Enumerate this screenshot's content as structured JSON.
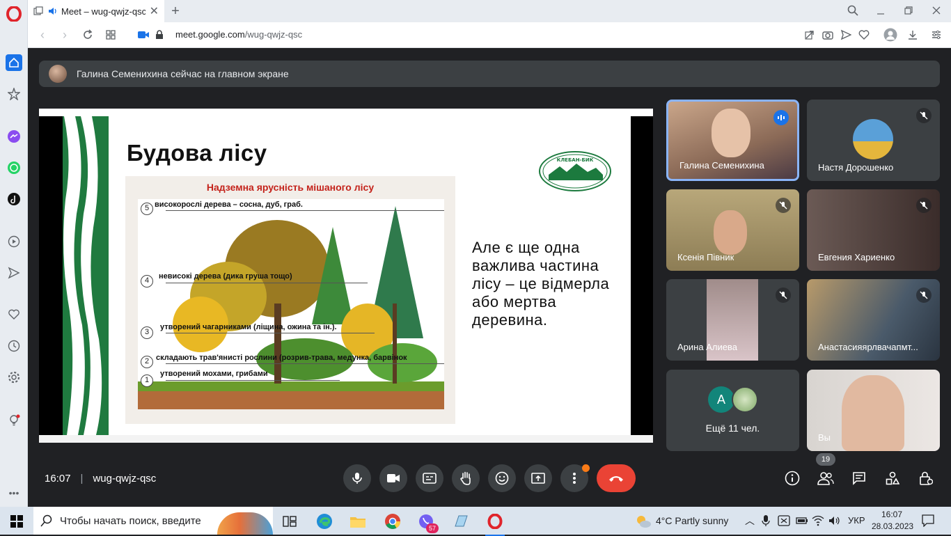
{
  "browser": {
    "tab_title": "Meet – wug-qwjz-qsc",
    "url_domain": "meet.google.com",
    "url_path": "/wug-qwjz-qsc"
  },
  "meet": {
    "presenter_banner": "Галина Семенихина сейчас на главном экране",
    "slide": {
      "title": "Будова лісу",
      "picture_title": "Надземна ярусність мішаного лісу",
      "layers": [
        {
          "num": "5",
          "text": "високорослі дерева – сосна, дуб, граб."
        },
        {
          "num": "4",
          "text": "невисокі дерева (дика груша тощо)"
        },
        {
          "num": "3",
          "text": "утворений чагарниками (ліщина, ожина та ін.)."
        },
        {
          "num": "2",
          "text": "складають трав'янисті рослини (розрив-трава, медунка, барвінок"
        },
        {
          "num": "1",
          "text": "утворений мохами, грибами"
        }
      ],
      "text": "Але є ще одна важлива частина лісу – це відмерла або мертва деревина.",
      "logo_text": "КЛЕБАН-БИК"
    },
    "participants": [
      {
        "name": "Галина Семенихина",
        "speaking": true
      },
      {
        "name": "Настя Дорошенко",
        "muted": true
      },
      {
        "name": "Ксенія Півник",
        "muted": true
      },
      {
        "name": "Евгения Хариенко",
        "muted": true
      },
      {
        "name": "Арина Алиева",
        "muted": true
      },
      {
        "name": "Анастасияярлвачапмт...",
        "muted": true
      },
      {
        "name": "Ещё 11 чел.",
        "avatar_letter": "А"
      },
      {
        "name": "Вы"
      }
    ],
    "time": "16:07",
    "meeting_code": "wug-qwjz-qsc",
    "participants_count": "19"
  },
  "taskbar": {
    "search_placeholder": "Чтобы начать поиск, введите",
    "weather": "4°C  Partly sunny",
    "lang": "УКР",
    "clock_time": "16:07",
    "clock_date": "28.03.2023",
    "viber_badge": "57"
  }
}
